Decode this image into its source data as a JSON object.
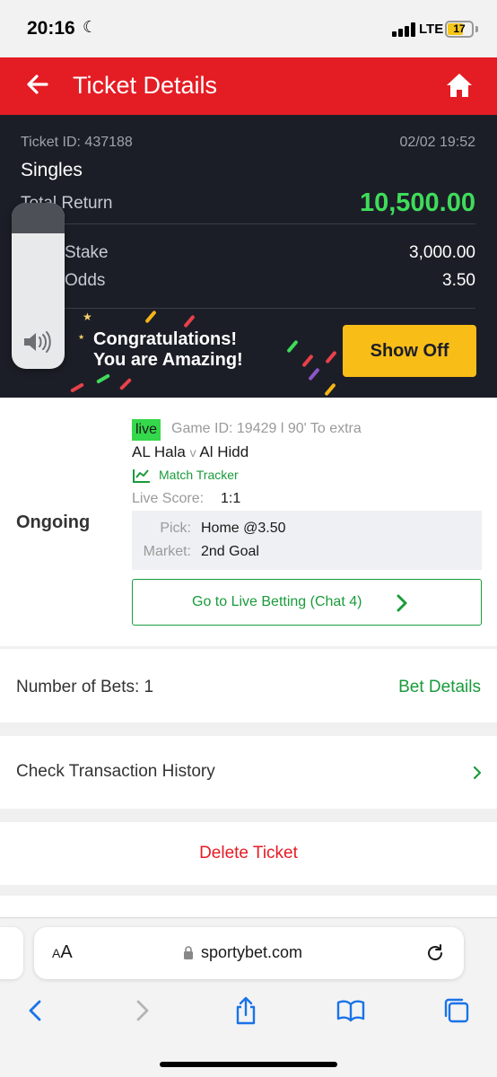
{
  "status_bar": {
    "time": "20:16",
    "network": "LTE",
    "battery": "17"
  },
  "header": {
    "title": "Ticket Details"
  },
  "summary": {
    "ticket_id": "Ticket ID: 437188",
    "date": "02/02 19:52",
    "bet_type": "Singles",
    "total_return_label": "Total Return",
    "total_return_value": "10,500.00",
    "stake_label": "Stake",
    "stake_value": "3,000.00",
    "odds_label": "Odds",
    "odds_value": "3.50",
    "congrats_line1": "Congratulations!",
    "congrats_line2": "You are Amazing!",
    "show_off_label": "Show Off"
  },
  "ticket": {
    "status": "Ongoing",
    "live_badge": "live",
    "game_id": "Game ID: 19429 l 90' To extra",
    "home_team": "AL Hala",
    "vs": "v",
    "away_team": "Al Hidd",
    "match_tracker": "Match Tracker",
    "live_score_label": "Live Score:",
    "live_score_value": "1:1",
    "pick_label": "Pick:",
    "pick_value": "Home @3.50",
    "market_label": "Market:",
    "market_value": "2nd Goal",
    "go_live_label": "Go to Live Betting (Chat 4)"
  },
  "bets": {
    "label": "Number of Bets: 1",
    "details_link": "Bet Details"
  },
  "history": {
    "label": "Check Transaction History"
  },
  "delete": {
    "label": "Delete Ticket"
  },
  "browser": {
    "domain": "sportybet.com",
    "text_size_label": "AA"
  },
  "colors": {
    "brand_red": "#e41c24",
    "accent_green": "#1a9b3b",
    "return_green": "#3fdc5a",
    "button_yellow": "#f8bd17",
    "dark_bg": "#1c1e27"
  }
}
